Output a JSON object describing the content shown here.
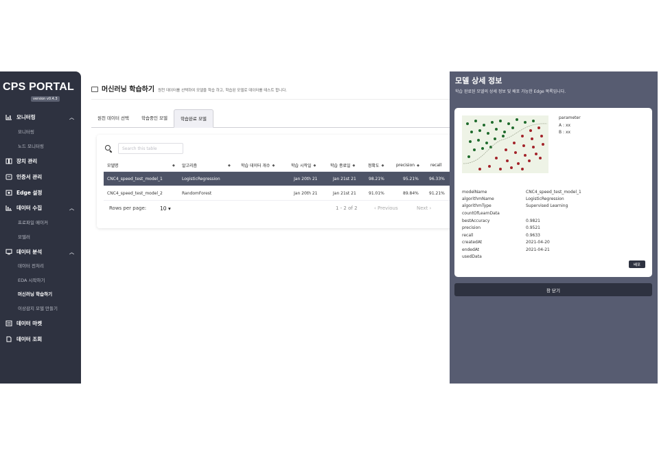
{
  "sidebar": {
    "brand": "CPS PORTAL",
    "version": "version v0.4.3",
    "groups": [
      {
        "label": "모니터링",
        "icon": "chart-icon",
        "chevron": "^",
        "subs": [
          "모니터링",
          "노드 모니터링"
        ]
      },
      {
        "label": "장치 관리",
        "icon": "book-icon"
      },
      {
        "label": "인증서 관리",
        "icon": "certificate-icon"
      },
      {
        "label": "Edge 설정",
        "icon": "edge-icon"
      },
      {
        "label": "데이터 수집",
        "icon": "database-icon",
        "chevron": "^",
        "subs": [
          "프로파일 메이커",
          "모델러"
        ]
      },
      {
        "label": "데이터 분석",
        "icon": "monitor-icon",
        "chevron": "^",
        "subs": [
          "데이터 전처리",
          "EDA 시작하기",
          "머신러닝 학습하기",
          "이상감지 모델 만들기"
        ]
      },
      {
        "label": "데이터 마켓",
        "icon": "list-icon"
      },
      {
        "label": "데이터 조회",
        "icon": "document-icon"
      }
    ],
    "active_sub": "머신러닝 학습하기"
  },
  "header": {
    "title": "머신러닝 학습하기",
    "description": "원천 데이터를 선택하여 모델을 학습 하고, 학습된 모델로 데이터를 테스트 합니다."
  },
  "tabs": [
    {
      "label": "원천 데이터 선택"
    },
    {
      "label": "학습중인 모델"
    },
    {
      "label": "학습완료 모델",
      "active": true
    }
  ],
  "table": {
    "search_placeholder": "Search this table",
    "columns": [
      "모델명",
      "알고리즘",
      "학습 데이터 개수",
      "학습 시작일",
      "학습 종료일",
      "정확도",
      "precision",
      "recall"
    ],
    "rows": [
      [
        "CNC4_speed_test_model_1",
        "LogisticRegression",
        "",
        "Jan 20th 21",
        "Jan 21st 21",
        "98.21%",
        "95.21%",
        "96.33%"
      ],
      [
        "CNC4_speed_test_model_2",
        "RandomForest",
        "",
        "Jan 20th 21",
        "Jan 21st 21",
        "91.01%",
        "89.84%",
        "91.21%"
      ]
    ],
    "selected_row": 0,
    "rows_per_page_label": "Rows per page:",
    "rows_per_page": "10",
    "range": "1 - 2 of 2",
    "prev": "‹  Previous",
    "next": "Next  ›"
  },
  "panel": {
    "title": "모델 상세 정보",
    "subtitle": "학습 완료된 모델의 상세 정보 및 배포 가능한 Edge 목록입니다.",
    "parameter_title": "parameter",
    "parameters": [
      "A : xx",
      "B : xx"
    ],
    "details": [
      {
        "key": "modelName",
        "value": "CNC4_speed_test_model_1"
      },
      {
        "key": "algorithmName",
        "value": "LogisticRegression"
      },
      {
        "key": "algorithmType",
        "value": "Supervised Learning"
      },
      {
        "key": "countOfLearnData",
        "value": ""
      },
      {
        "key": "bestAccuracy",
        "value": "0.9821"
      },
      {
        "key": "precision",
        "value": "0.9521"
      },
      {
        "key": "recall",
        "value": "0.9633"
      },
      {
        "key": "createdAt",
        "value": "2021-04-20"
      },
      {
        "key": "endedAt",
        "value": "2021-04-21"
      },
      {
        "key": "usedData",
        "value": ""
      }
    ],
    "deploy_label": "배포",
    "close_label": "창 닫기",
    "colors": {
      "green": "#1f6b2c",
      "red": "#a3232a"
    }
  }
}
